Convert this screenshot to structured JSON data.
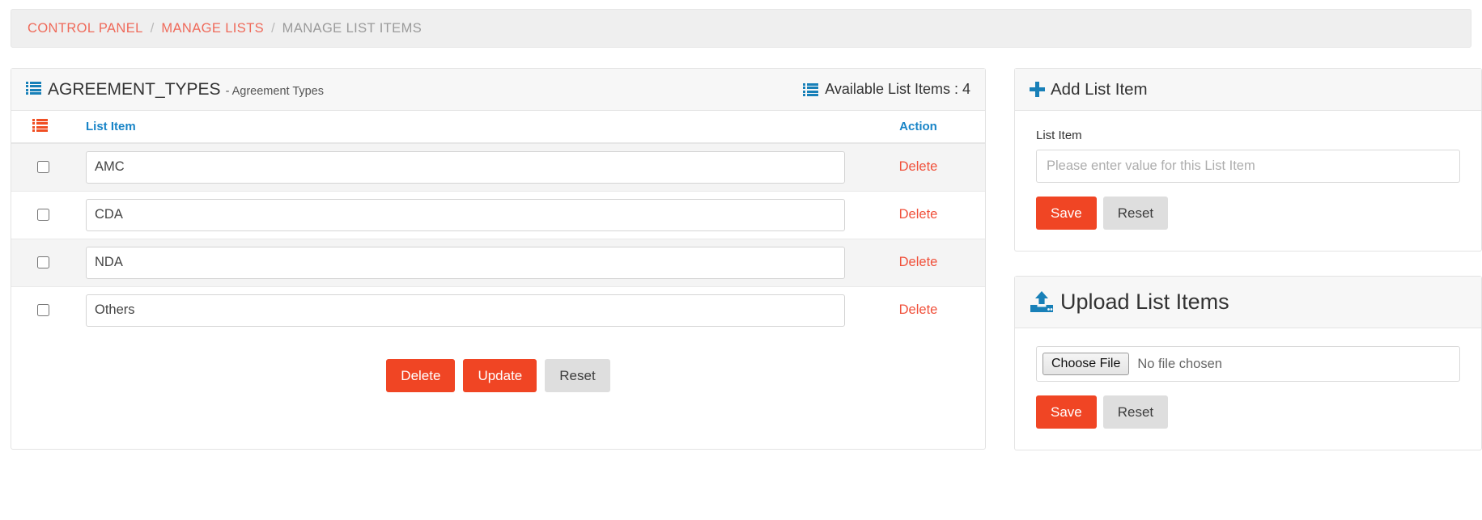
{
  "breadcrumb": {
    "items": [
      {
        "label": "CONTROL PANEL",
        "current": false
      },
      {
        "label": "MANAGE LISTS",
        "current": false
      },
      {
        "label": "MANAGE LIST ITEMS",
        "current": true
      }
    ],
    "separator": "/"
  },
  "list_panel": {
    "icon": "list-icon",
    "title": "AGREEMENT_TYPES",
    "subtitle": "- Agreement Types",
    "count_icon": "list-icon",
    "count_label": "Available List Items : 4",
    "table": {
      "header_icon": "list-icon",
      "columns": [
        "",
        "List Item",
        "Action"
      ],
      "rows": [
        {
          "value": "AMC",
          "action": "Delete",
          "checked": false
        },
        {
          "value": "CDA",
          "action": "Delete",
          "checked": false
        },
        {
          "value": "NDA",
          "action": "Delete",
          "checked": false
        },
        {
          "value": "Others",
          "action": "Delete",
          "checked": false
        }
      ]
    },
    "actions": {
      "delete": "Delete",
      "update": "Update",
      "reset": "Reset"
    }
  },
  "add_panel": {
    "icon": "plus-icon",
    "title": "Add List Item",
    "field_label": "List Item",
    "input_value": "",
    "input_placeholder": "Please enter value for this List Item",
    "save_label": "Save",
    "reset_label": "Reset"
  },
  "upload_panel": {
    "icon": "upload-icon",
    "title": "Upload List Items",
    "choose_label": "Choose File",
    "file_status": "No file chosen",
    "save_label": "Save",
    "reset_label": "Reset"
  },
  "colors": {
    "accent_red": "#f04524",
    "accent_blue": "#1884c7",
    "icon_blue": "#1880b8",
    "icon_red": "#f04e23",
    "link_red": "#f0503a",
    "breadcrumb_link": "#ef6a5a",
    "breadcrumb_current": "#9a9a9a",
    "panel_head_bg": "#f7f7f7",
    "stripe_bg": "#f4f4f4"
  }
}
